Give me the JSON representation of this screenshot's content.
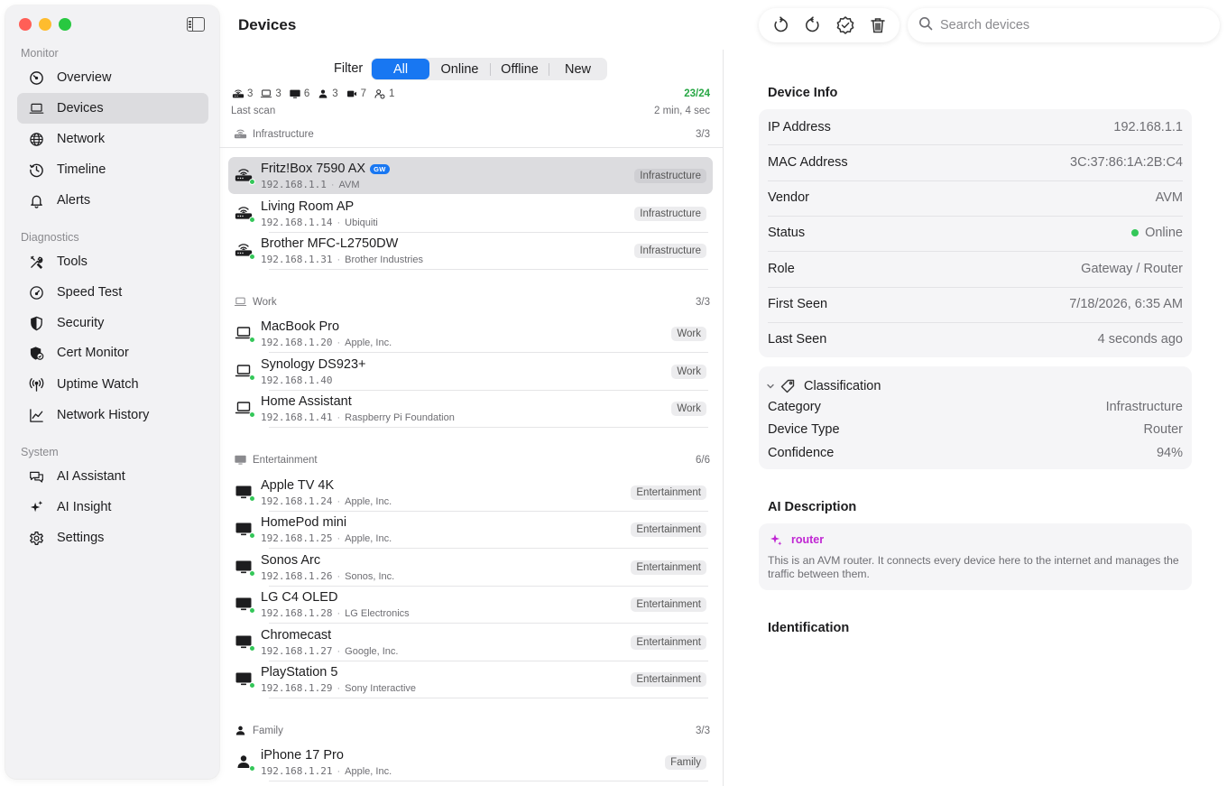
{
  "app": {
    "title": "Devices"
  },
  "sidebar": {
    "sections": [
      {
        "title": "Monitor",
        "items": [
          {
            "label": "Overview",
            "icon": "gauge-icon"
          },
          {
            "label": "Devices",
            "icon": "laptop-icon",
            "active": true
          },
          {
            "label": "Network",
            "icon": "globe-icon"
          },
          {
            "label": "Timeline",
            "icon": "clock-icon"
          },
          {
            "label": "Alerts",
            "icon": "bell-icon"
          }
        ]
      },
      {
        "title": "Diagnostics",
        "items": [
          {
            "label": "Tools",
            "icon": "tools-icon"
          },
          {
            "label": "Speed Test",
            "icon": "speedometer-icon"
          },
          {
            "label": "Security",
            "icon": "shield-icon"
          },
          {
            "label": "Cert Monitor",
            "icon": "cert-shield-icon"
          },
          {
            "label": "Uptime Watch",
            "icon": "antenna-icon"
          },
          {
            "label": "Network History",
            "icon": "chart-line-icon"
          }
        ]
      },
      {
        "title": "System",
        "items": [
          {
            "label": "AI Assistant",
            "icon": "chat-bubbles-icon"
          },
          {
            "label": "AI Insight",
            "icon": "sparkles-icon"
          },
          {
            "label": "Settings",
            "icon": "gear-icon"
          }
        ]
      }
    ]
  },
  "toolbar": {
    "icons": [
      "rotate-left-icon",
      "rotate-right-icon",
      "verified-badge-icon",
      "trash-icon"
    ]
  },
  "search": {
    "placeholder": "Search devices",
    "value": ""
  },
  "filter": {
    "label": "Filter",
    "options": [
      "All",
      "Online",
      "Offline",
      "New"
    ],
    "selected": "All"
  },
  "stats": {
    "counts": [
      {
        "icon": "router-icon",
        "value": "3"
      },
      {
        "icon": "laptop-icon",
        "value": "3"
      },
      {
        "icon": "monitor-icon",
        "value": "6"
      },
      {
        "icon": "person-icon",
        "value": "3"
      },
      {
        "icon": "camera-icon",
        "value": "7"
      },
      {
        "icon": "person-question-icon",
        "value": "1"
      }
    ],
    "ratio": "23/24",
    "last_scan_label": "Last scan",
    "last_scan_value": "2 min, 4 sec"
  },
  "groups": [
    {
      "name": "Infrastructure",
      "icon": "router-icon",
      "count": "3/3",
      "devices": [
        {
          "name": "Fritz!Box 7590 AX",
          "ip": "192.168.1.1",
          "vendor": "AVM",
          "category": "Infrastructure",
          "badge": "GW",
          "icon": "router-icon",
          "selected": true
        },
        {
          "name": "Living Room AP",
          "ip": "192.168.1.14",
          "vendor": "Ubiquiti",
          "category": "Infrastructure",
          "icon": "router-icon"
        },
        {
          "name": "Brother MFC-L2750DW",
          "ip": "192.168.1.31",
          "vendor": "Brother Industries",
          "category": "Infrastructure",
          "icon": "router-icon"
        }
      ]
    },
    {
      "name": "Work",
      "icon": "laptop-icon",
      "count": "3/3",
      "devices": [
        {
          "name": "MacBook Pro",
          "ip": "192.168.1.20",
          "vendor": "Apple, Inc.",
          "category": "Work",
          "icon": "laptop-icon"
        },
        {
          "name": "Synology DS923+",
          "ip": "192.168.1.40",
          "vendor": "",
          "category": "Work",
          "icon": "laptop-icon"
        },
        {
          "name": "Home Assistant",
          "ip": "192.168.1.41",
          "vendor": "Raspberry Pi Foundation",
          "category": "Work",
          "icon": "laptop-icon"
        }
      ]
    },
    {
      "name": "Entertainment",
      "icon": "monitor-icon",
      "count": "6/6",
      "devices": [
        {
          "name": "Apple TV 4K",
          "ip": "192.168.1.24",
          "vendor": "Apple, Inc.",
          "category": "Entertainment",
          "icon": "monitor-icon"
        },
        {
          "name": "HomePod mini",
          "ip": "192.168.1.25",
          "vendor": "Apple, Inc.",
          "category": "Entertainment",
          "icon": "monitor-icon"
        },
        {
          "name": "Sonos Arc",
          "ip": "192.168.1.26",
          "vendor": "Sonos, Inc.",
          "category": "Entertainment",
          "icon": "monitor-icon"
        },
        {
          "name": "LG C4 OLED",
          "ip": "192.168.1.28",
          "vendor": "LG Electronics",
          "category": "Entertainment",
          "icon": "monitor-icon"
        },
        {
          "name": "Chromecast",
          "ip": "192.168.1.27",
          "vendor": "Google, Inc.",
          "category": "Entertainment",
          "icon": "monitor-icon"
        },
        {
          "name": "PlayStation 5",
          "ip": "192.168.1.29",
          "vendor": "Sony Interactive",
          "category": "Entertainment",
          "icon": "monitor-icon"
        }
      ]
    },
    {
      "name": "Family",
      "icon": "person-icon",
      "count": "3/3",
      "devices": [
        {
          "name": "iPhone 17 Pro",
          "ip": "192.168.1.21",
          "vendor": "Apple, Inc.",
          "category": "Family",
          "icon": "person-icon"
        }
      ]
    }
  ],
  "detail": {
    "device_info_title": "Device Info",
    "info": [
      {
        "key": "IP Address",
        "value": "192.168.1.1"
      },
      {
        "key": "MAC Address",
        "value": "3C:37:86:1A:2B:C4"
      },
      {
        "key": "Vendor",
        "value": "AVM"
      },
      {
        "key": "Status",
        "value": "Online",
        "status_dot": true
      },
      {
        "key": "Role",
        "value": "Gateway / Router"
      },
      {
        "key": "First Seen",
        "value": "7/18/2026, 6:35 AM"
      },
      {
        "key": "Last Seen",
        "value": "4 seconds ago"
      }
    ],
    "classification": {
      "title": "Classification",
      "rows": [
        {
          "key": "Category",
          "value": "Infrastructure"
        },
        {
          "key": "Device Type",
          "value": "Router"
        },
        {
          "key": "Confidence",
          "value": "94%"
        }
      ]
    },
    "ai_description_title": "AI Description",
    "ai": {
      "label": "router",
      "text": "This is an AVM router. It connects every device here to the internet and manages the traffic between them."
    },
    "identification_title": "Identification"
  },
  "colors": {
    "accent": "#1877f2",
    "online": "#34c759",
    "ratio": "#28a745",
    "ai": "#c026d3"
  }
}
